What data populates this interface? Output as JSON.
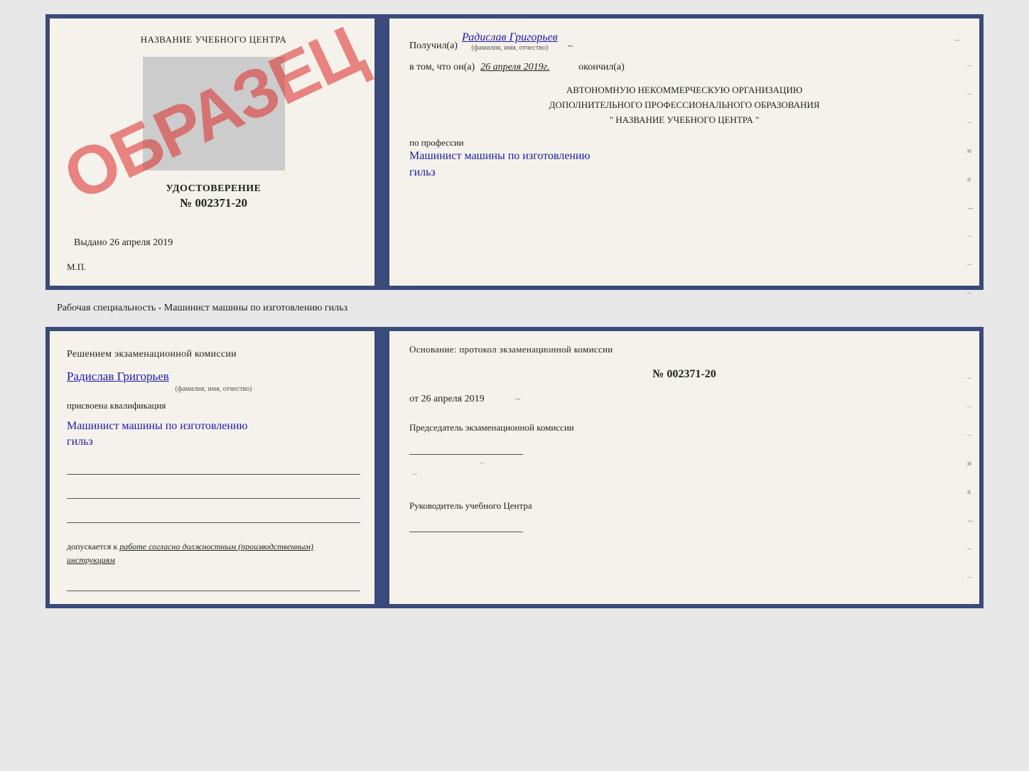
{
  "topDoc": {
    "left": {
      "schoolTitle": "НАЗВАНИЕ УЧЕБНОГО ЦЕНТРА",
      "stampText": "ОБРАЗЕЦ",
      "certTitle": "УДОСТОВЕРЕНИЕ",
      "certNumber": "№ 002371-20",
      "vydano": "Выдано 26 апреля 2019",
      "mp": "М.П."
    },
    "right": {
      "receivedLabel": "Получил(а)",
      "receivedName": "Радислав Григорьев",
      "fioLabel": "(фамилия, имя, отчество)",
      "dash": "–",
      "vtomLabel": "в том, что он(а)",
      "date": "26 апреля 2019г.",
      "okonchilLabel": "окончил(а)",
      "orgLine1": "АВТОНОМНУЮ НЕКОММЕРЧЕСКУЮ ОРГАНИЗАЦИЮ",
      "orgLine2": "ДОПОЛНИТЕЛЬНОГО ПРОФЕССИОНАЛЬНОГО ОБРАЗОВАНИЯ",
      "orgLine3": "\" НАЗВАНИЕ УЧЕБНОГО ЦЕНТРА \"",
      "professionLabel": "по профессии",
      "professionName": "Машинист машины по изготовлению",
      "professionName2": "гильз",
      "sideMarks": [
        "–",
        "–",
        "–",
        "и",
        "а",
        "←",
        "–",
        "–",
        "–"
      ]
    }
  },
  "betweenLabel": "Рабочая специальность - Машинист машины по изготовлению гильз",
  "bottomDoc": {
    "left": {
      "decisionTitle": "Решением  экзаменационной  комиссии",
      "personName": "Радислав Григорьев",
      "fioLabel": "(фамилия, имя, отчество)",
      "prisvoenaLabel": "присвоена квалификация",
      "qualificationName": "Машинист машины по изготовлению",
      "qualificationName2": "гильз",
      "dopuskaetsyaLabel": "допускается к",
      "dopuskaetsyaText": "работе согласно должностным (производственным) инструкциям"
    },
    "right": {
      "osnovaniеLabel": "Основание:  протокол  экзаменационной  комиссии",
      "protocolNumber": "№  002371-20",
      "protocolDatePrefix": "от",
      "protocolDate": "26 апреля 2019",
      "chairmanLabel": "Председатель экзаменационной комиссии",
      "rukovoditelLabel": "Руководитель учебного Центра",
      "sideMarks": [
        "–",
        "–",
        "–",
        "и",
        "а",
        "←",
        "–",
        "–",
        "–"
      ]
    }
  }
}
